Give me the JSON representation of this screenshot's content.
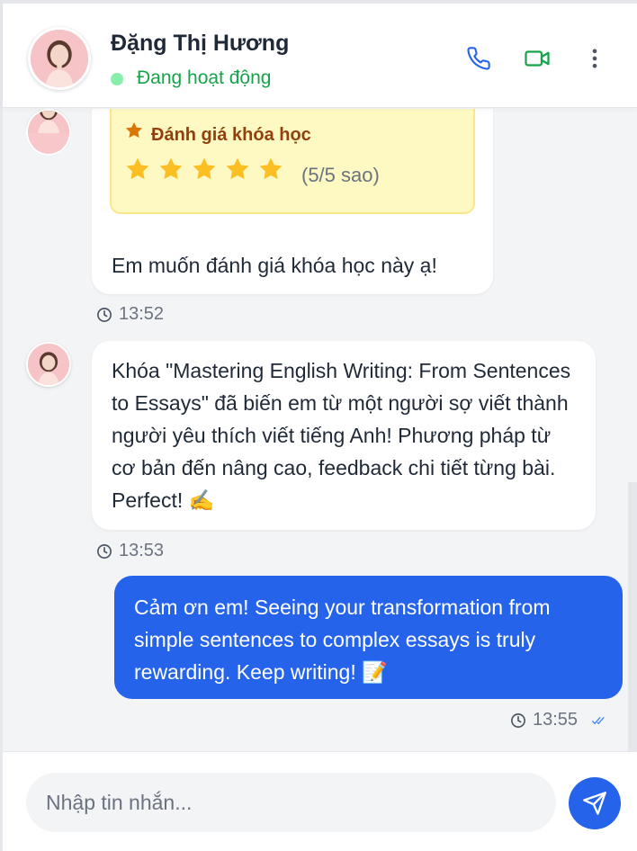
{
  "header": {
    "contact_name": "Đặng Thị Hương",
    "status": "Đang hoạt động",
    "call_icon": "phone-icon",
    "video_icon": "video-icon",
    "more_icon": "more-vertical-icon"
  },
  "messages": [
    {
      "direction": "incoming",
      "rating_card": {
        "title": "Đánh giá khóa học",
        "stars": 5,
        "max_stars": 5,
        "rating_text": "(5/5 sao)"
      },
      "text": "Em muốn đánh giá khóa học này ạ!",
      "time": "13:52"
    },
    {
      "direction": "incoming",
      "text": "Khóa \"Mastering English Writing: From Sentences to Essays\" đã biến em từ một người sợ viết thành người yêu thích viết tiếng Anh! Phương pháp từ cơ bản đến nâng cao, feedback chi tiết từng bài. Perfect! ✍️",
      "time": "13:53"
    },
    {
      "direction": "outgoing",
      "text": "Cảm ơn em! Seeing your transformation from simple sentences to complex essays is truly rewarding. Keep writing! 📝",
      "time": "13:55",
      "read": true
    }
  ],
  "composer": {
    "placeholder": "Nhập tin nhắn...",
    "send_icon": "send-icon"
  },
  "colors": {
    "accent": "#2563eb",
    "online": "#16a34a",
    "rating_bg": "#fef9c3",
    "star": "#fbbf24"
  }
}
